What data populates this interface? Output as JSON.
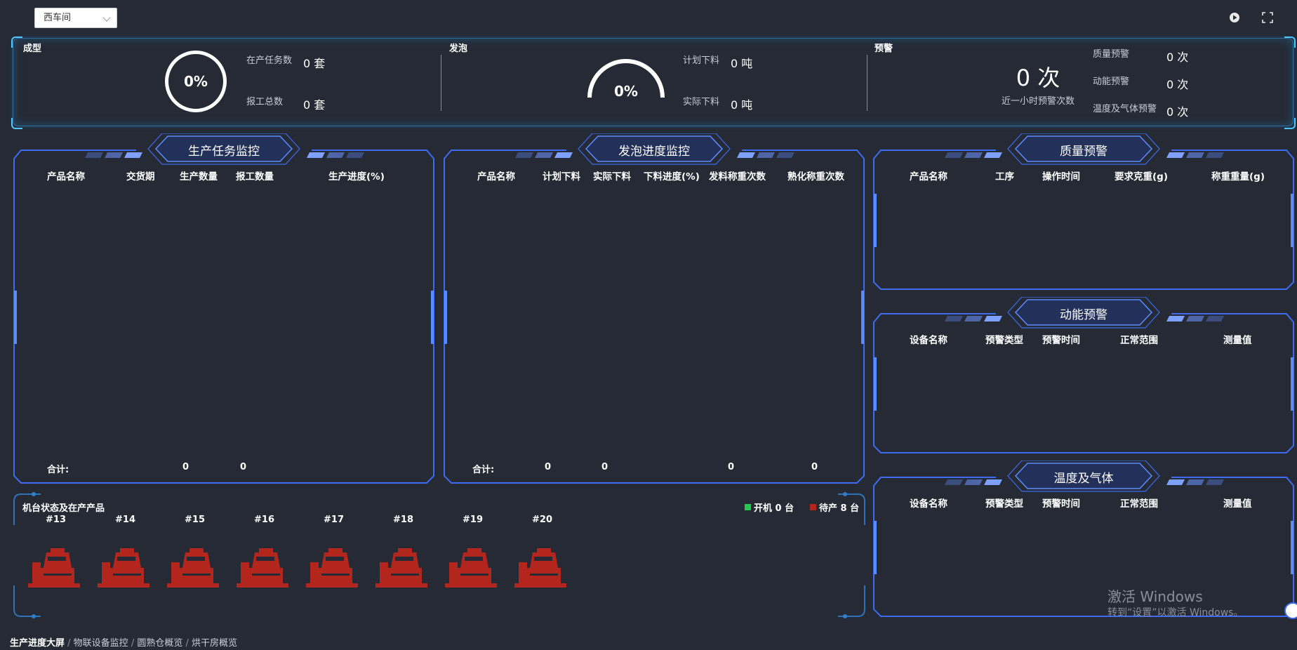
{
  "topbar": {
    "workshop_select": "西车间",
    "play_icon": "play-circle-icon",
    "fullscreen_icon": "fullscreen-icon"
  },
  "stats": {
    "forming": {
      "title": "成型",
      "progress_text": "0%",
      "tasks_label": "在产任务数",
      "tasks_value": "0 套",
      "reports_label": "报工总数",
      "reports_value": "0 套"
    },
    "foaming": {
      "title": "发泡",
      "progress_text": "0%",
      "planned_label": "计划下料",
      "planned_value": "0 吨",
      "actual_label": "实际下料",
      "actual_value": "0 吨"
    },
    "warning": {
      "title": "预警",
      "big_value": "0 次",
      "big_label": "近一小时预警次数",
      "quality_label": "质量预警",
      "quality_value": "0 次",
      "energy_label": "动能预警",
      "energy_value": "0 次",
      "temp_label": "温度及气体预警",
      "temp_value": "0 次"
    }
  },
  "production_panel": {
    "title": "生产任务监控",
    "columns": [
      "产品名称",
      "交货期",
      "生产数量",
      "报工数量",
      "生产进度(%)"
    ],
    "total_label": "合计:",
    "total_qty": "0",
    "total_report": "0"
  },
  "foaming_panel": {
    "title": "发泡进度监控",
    "columns": [
      "产品名称",
      "计划下料",
      "实际下料",
      "下料进度(%)",
      "发料称重次数",
      "熟化称重次数"
    ],
    "total_label": "合计:",
    "total_plan": "0",
    "total_actual": "0",
    "total_issue_weigh": "0",
    "total_cure_weigh": "0"
  },
  "quality_panel": {
    "title": "质量预警",
    "columns": [
      "产品名称",
      "工序",
      "操作时间",
      "要求克重(g)",
      "称重重量(g)"
    ]
  },
  "energy_panel": {
    "title": "动能预警",
    "columns": [
      "设备名称",
      "预警类型",
      "预警时间",
      "正常范围",
      "测量值"
    ]
  },
  "gas_panel": {
    "title": "温度及气体",
    "columns": [
      "设备名称",
      "预警类型",
      "预警时间",
      "正常范围",
      "测量值"
    ]
  },
  "machines": {
    "title": "机台状态及在产产品",
    "legend_on": "开机 0 台",
    "legend_off": "待产 8 台",
    "color_on": "#22c94a",
    "color_off": "#b3261e",
    "items": [
      {
        "label": "#13",
        "status": "off"
      },
      {
        "label": "#14",
        "status": "off"
      },
      {
        "label": "#15",
        "status": "off"
      },
      {
        "label": "#16",
        "status": "off"
      },
      {
        "label": "#17",
        "status": "off"
      },
      {
        "label": "#18",
        "status": "off"
      },
      {
        "label": "#19",
        "status": "off"
      },
      {
        "label": "#20",
        "status": "off"
      }
    ]
  },
  "breadcrumb": [
    "生产进度大屏",
    "物联设备监控",
    "圆熟仓概览",
    "烘干房概览"
  ],
  "watermark": {
    "line1": "激活 Windows",
    "line2": "转到“设置”以激活 Windows。"
  },
  "colors": {
    "background": "#252a35",
    "frame_blue": "#3d6cf0",
    "stats_border": "#2d6fa0",
    "machine_red": "#b3261e"
  }
}
